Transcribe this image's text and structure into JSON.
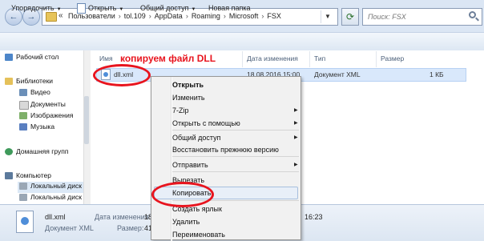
{
  "address": {
    "prefix": "«",
    "crumbs": [
      "Пользователи",
      "tol.109",
      "AppData",
      "Roaming",
      "Microsoft",
      "FSX"
    ],
    "search_placeholder": "Поиск: FSX"
  },
  "toolbar": {
    "organize": "Упорядочить",
    "open": "Открыть",
    "share": "Общий доступ",
    "new_folder": "Новая папка"
  },
  "nav": {
    "desktop": "Рабочий стол",
    "libraries": "Библиотеки",
    "video": "Видео",
    "documents": "Документы",
    "images": "Изображения",
    "music": "Музыка",
    "homegroup": "Домашняя групп",
    "computer": "Компьютер",
    "local_disk_1": "Локальный диск",
    "local_disk_2": "Локальный диск"
  },
  "columns": {
    "name": "Имя",
    "date": "Дата изменения",
    "type": "Тип",
    "size": "Размер"
  },
  "file": {
    "name": "dll.xml",
    "date": "18.08.2016 15:00",
    "type": "Документ XML",
    "size": "1 КБ"
  },
  "annotation": "копируем файл DLL",
  "context_menu": {
    "open": "Открыть",
    "edit": "Изменить",
    "zip": "7-Zip",
    "open_with": "Открыть с помощью",
    "share": "Общий доступ",
    "restore": "Восстановить прежнюю версию",
    "send_to": "Отправить",
    "cut": "Вырезать",
    "copy": "Копировать",
    "shortcut": "Создать ярлык",
    "delete": "Удалить",
    "rename": "Переименовать"
  },
  "details": {
    "filename": "dll.xml",
    "filetype": "Документ XML",
    "date_label": "Дата изменения:",
    "date_value_partial": "18",
    "size_label": "Размер:",
    "size_value_partial": "41",
    "time_partial": "16:23"
  },
  "colors": {
    "annotation_red": "#e8141e",
    "selection_blue": "#d9e8fb",
    "chrome_blue": "#dbe6f4"
  }
}
